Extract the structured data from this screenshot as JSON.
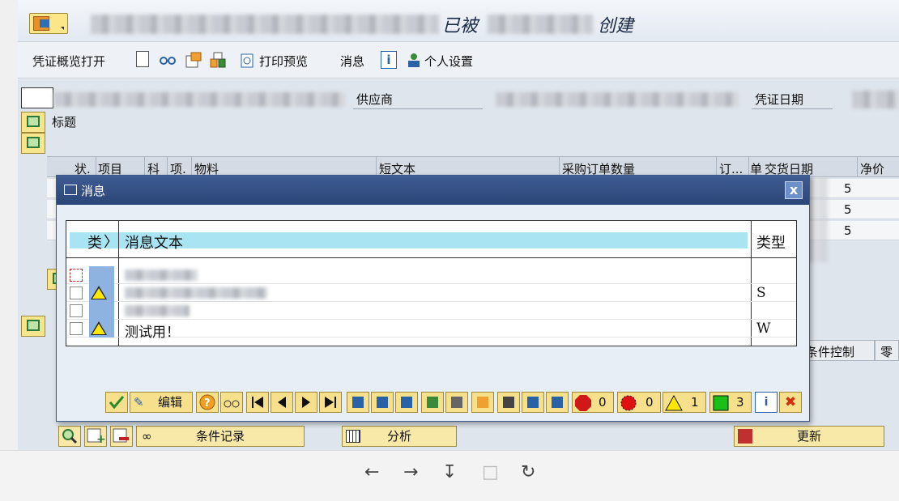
{
  "title": {
    "part1": "已被",
    "part2": "创建"
  },
  "toolbar": {
    "doc_overview": "凭证概览打开",
    "print_preview": "打印预览",
    "messages": "消息",
    "personal_settings": "个人设置"
  },
  "header_fields": {
    "vendor": "供应商",
    "doc_date": "凭证日期",
    "header_label": "标题"
  },
  "grid": {
    "columns": [
      "状.",
      "项目",
      "科",
      "项.",
      "物料",
      "短文本",
      "采购订单数量",
      "订...",
      "单",
      "交货日期",
      "净价"
    ],
    "date_suffixes": [
      "5",
      "5",
      "5"
    ]
  },
  "tabs": [
    "条件控制",
    "零"
  ],
  "bottom_buttons": {
    "condition_records": "条件记录",
    "analysis": "分析",
    "update": "更新"
  },
  "dialog": {
    "title": "消息",
    "close": "x",
    "col_type": "类",
    "col_text": "消息文本",
    "col_msgtype": "类型",
    "rows": [
      {
        "warning": false,
        "text": "",
        "type": ""
      },
      {
        "warning": true,
        "text": "",
        "type": "S"
      },
      {
        "warning": false,
        "text": "",
        "type": ""
      },
      {
        "warning": true,
        "text": "测试用！",
        "type": "W"
      }
    ],
    "footer": {
      "edit": "编辑",
      "stop_count": "0",
      "error_count": "0",
      "warning_count": "1",
      "success_count": "3"
    }
  },
  "colors": {
    "dialog_title": "#2a4577",
    "header_cyan": "#a8e4f2",
    "button_yellow": "#f7e08c"
  }
}
